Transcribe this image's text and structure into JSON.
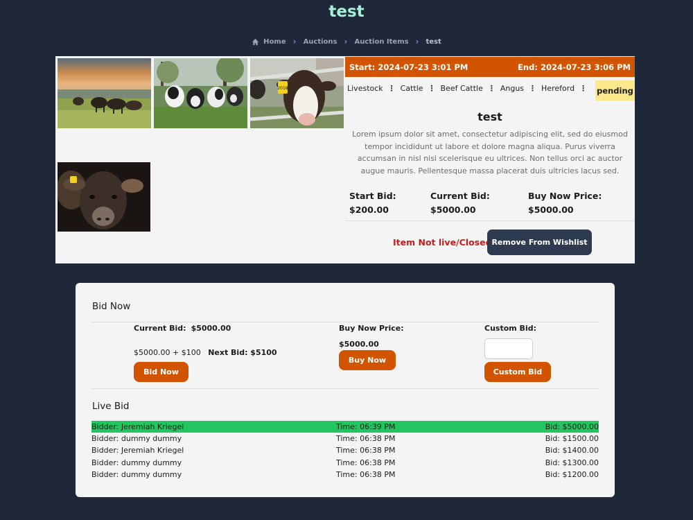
{
  "page_title": "test",
  "breadcrumb": [
    {
      "label": "Home",
      "icon": "home-icon"
    },
    {
      "label": "Auctions"
    },
    {
      "label": "Auction Items"
    },
    {
      "label": "test"
    }
  ],
  "item": {
    "start": "Start: 2024-07-23 3:01 PM",
    "end": "End: 2024-07-23 3:06 PM",
    "categories": [
      "Livestock",
      "Cattle",
      "Beef Cattle",
      "Angus",
      "Hereford"
    ],
    "status": "pending",
    "title": "test",
    "description": "Lorem ipsum dolor sit amet, consectetur adipiscing elit, sed do eiusmod tempor incididunt ut labore et dolore magna aliqua. Purus viverra accumsan in nisl nisi scelerisque eu ultrices. Non tellus orci ac auctor augue mauris. Pellentesque massa placerat duis ultricies lacus sed.",
    "start_bid_label": "Start Bid:",
    "start_bid": "$200.00",
    "current_bid_label": "Current Bid:",
    "current_bid": "$5000.00",
    "buy_now_label": "Buy Now Price:",
    "buy_now": "$5000.00",
    "live_status": "Item Not live/Closed",
    "wishlist_button": "Remove From Wishlist"
  },
  "colors": {
    "accent": "#d35400",
    "background": "#1e2839",
    "highlight": "#22c55e",
    "danger": "#c81e1e"
  },
  "bid_now": {
    "heading": "Bid Now",
    "current_bid_label": "Current Bid:",
    "current_bid_value": "$5000.00",
    "increment_text": "$5000.00 + $100",
    "next_bid": "Next Bid: $5100",
    "bid_button": "Bid Now",
    "buy_now_label": "Buy Now Price:",
    "buy_now_value": "$5000.00",
    "buy_now_button": "Buy Now",
    "custom_bid_label": "Custom Bid:",
    "custom_bid_value": "",
    "custom_bid_button": "Custom Bid"
  },
  "live_bid": {
    "heading": "Live Bid",
    "rows": [
      {
        "bidder": "Bidder: Jeremiah Kriegel",
        "time": "Time: 06:39 PM",
        "bid": "Bid: $5000.00",
        "highlight": true
      },
      {
        "bidder": "Bidder: dummy dummy",
        "time": "Time: 06:38 PM",
        "bid": "Bid: $1500.00",
        "highlight": false
      },
      {
        "bidder": "Bidder: Jeremiah Kriegel",
        "time": "Time: 06:38 PM",
        "bid": "Bid: $1400.00",
        "highlight": false
      },
      {
        "bidder": "Bidder: dummy dummy",
        "time": "Time: 06:38 PM",
        "bid": "Bid: $1300.00",
        "highlight": false
      },
      {
        "bidder": "Bidder: dummy dummy",
        "time": "Time: 06:38 PM",
        "bid": "Bid: $1200.00",
        "highlight": false
      }
    ]
  }
}
